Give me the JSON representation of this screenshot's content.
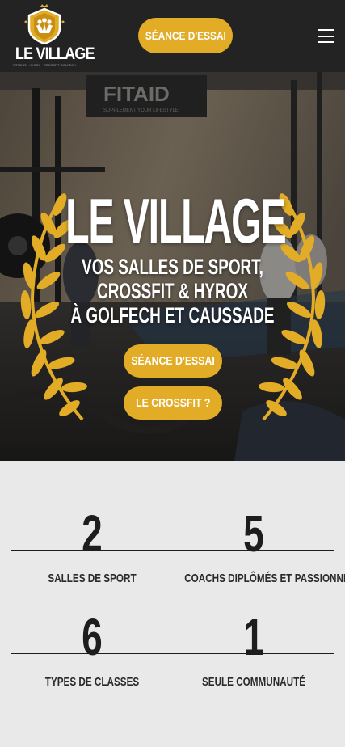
{
  "header": {
    "logo_text": "LE VILLAGE",
    "logo_tagline": "FITNESS · HYROX · CROSSFIT GOLFECH",
    "cta_label": "SÉANCE D'ESSAI",
    "menu_icon": "hamburger-menu-icon"
  },
  "hero": {
    "title": "LE VILLAGE",
    "subtitle_lines": [
      "VOS SALLES DE SPORT,",
      "CROSSFIT & HYROX",
      "À GOLFECH ET CAUSSADE"
    ],
    "buttons": [
      "SÉANCE D'ESSAI",
      "LE CROSSFIT ?"
    ],
    "background_sign": "FITAID",
    "background_sign_tagline": "SUPPLEMENT YOUR LIFESTYLE"
  },
  "stats": [
    {
      "number": "2",
      "label": "SALLES DE SPORT"
    },
    {
      "number": "5",
      "label": "COACHS DIPLÔMÉS ET PASSIONNÉS"
    },
    {
      "number": "6",
      "label": "TYPES DE CLASSES"
    },
    {
      "number": "1",
      "label": "SEULE COMMUNAUTÉ"
    }
  ],
  "colors": {
    "accent": "#e2ac27",
    "header_bg": "#232323",
    "stats_bg": "#e9e9e9",
    "text_dark": "#1d1d1d"
  }
}
